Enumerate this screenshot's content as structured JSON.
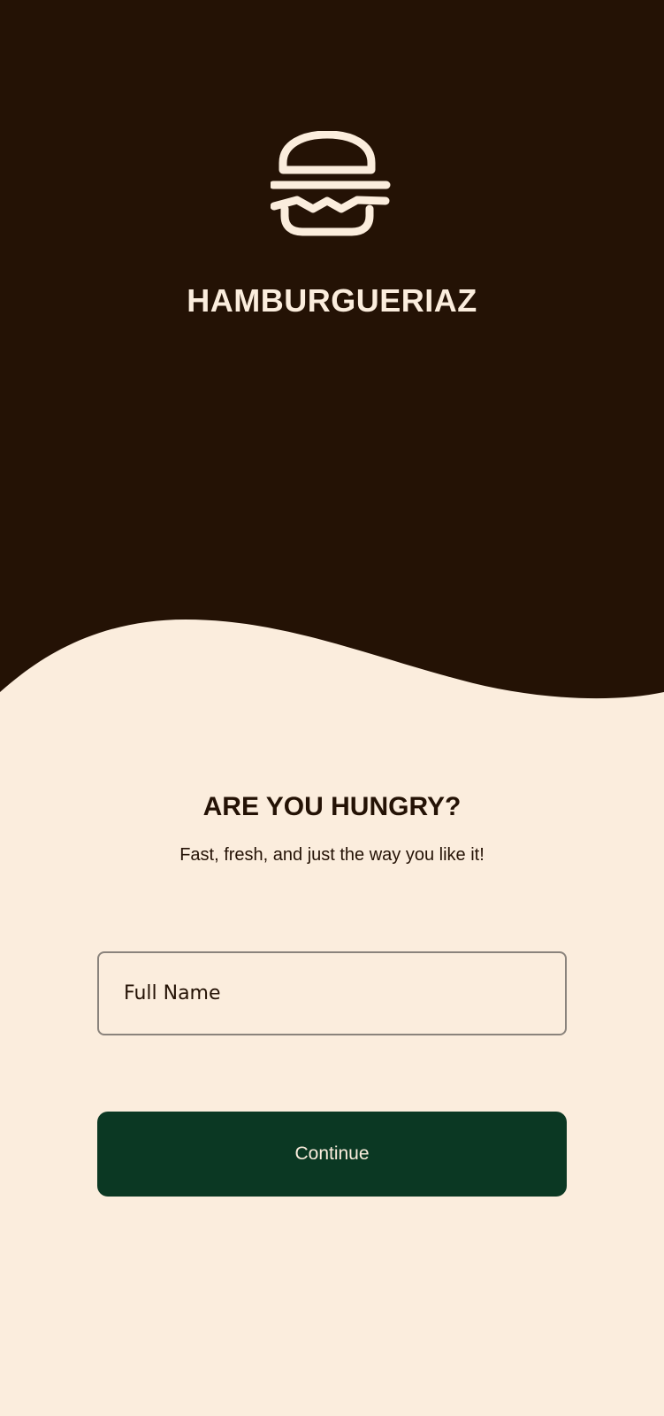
{
  "brand": {
    "name": "HAMBURGUERIAZ",
    "logo_icon": "burger-icon"
  },
  "welcome": {
    "headline": "ARE YOU HUNGRY?",
    "tagline": "Fast, fresh, and just the way you like it!"
  },
  "form": {
    "full_name": {
      "placeholder": "Full Name",
      "value": ""
    },
    "continue_label": "Continue"
  },
  "colors": {
    "hero_background": "#241205",
    "page_background": "#FBEDDD",
    "accent_text": "#FBEDDD",
    "button_background": "#0B3823",
    "input_border": "#8A837C"
  }
}
